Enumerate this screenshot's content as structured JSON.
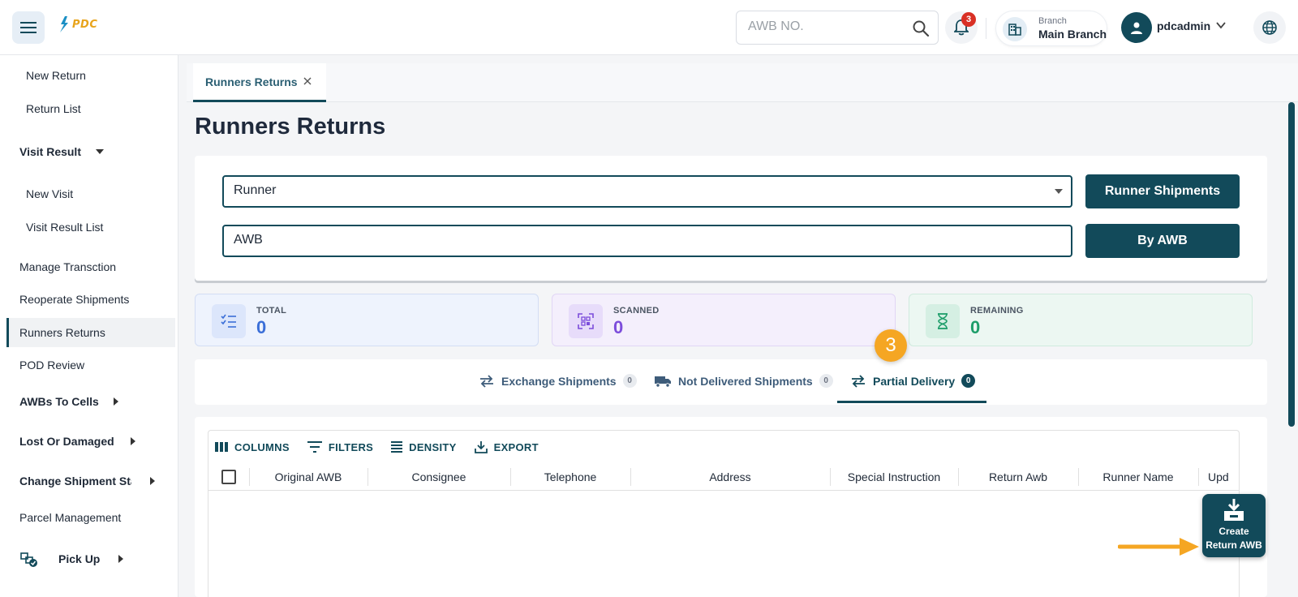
{
  "header": {
    "logo_text": "PDC",
    "search_placeholder": "AWB NO.",
    "notification_count": "3",
    "branch_caption": "Branch",
    "branch_name": "Main Branch",
    "username": "pdcadmin"
  },
  "sidebar": {
    "items": [
      {
        "label": "New Return"
      },
      {
        "label": "Return List"
      },
      {
        "label": "Visit Result"
      },
      {
        "label": "New Visit"
      },
      {
        "label": "Visit Result List"
      },
      {
        "label": "Manage Transction"
      },
      {
        "label": "Reoperate Shipments"
      },
      {
        "label": "Runners Returns"
      },
      {
        "label": "POD Review"
      },
      {
        "label": "AWBs To Cells"
      },
      {
        "label": "Lost Or Damaged"
      },
      {
        "label": "Change Shipment Sta"
      },
      {
        "label": "Parcel Management"
      },
      {
        "label": "Pick Up"
      }
    ]
  },
  "tabs": {
    "active_tab": "Runners Returns"
  },
  "page": {
    "title": "Runners Returns"
  },
  "form": {
    "runner_placeholder": "Runner",
    "awb_placeholder": "AWB",
    "runner_button": "Runner Shipments",
    "awb_button": "By AWB"
  },
  "stats": {
    "total_label": "TOTAL",
    "total_value": "0",
    "scanned_label": "SCANNED",
    "scanned_value": "0",
    "remaining_label": "REMAINING",
    "remaining_value": "0"
  },
  "subtabs": {
    "exchange_label": "Exchange Shipments",
    "exchange_count": "0",
    "not_delivered_label": "Not Delivered Shipments",
    "not_delivered_count": "0",
    "partial_label": "Partial Delivery",
    "partial_count": "0",
    "active": "Partial Delivery"
  },
  "step_badge": "3",
  "grid": {
    "toolbar": {
      "columns": "COLUMNS",
      "filters": "FILTERS",
      "density": "DENSITY",
      "export": "EXPORT"
    },
    "columns": [
      "Original AWB",
      "Consignee",
      "Telephone",
      "Address",
      "Special Instruction",
      "Return Awb",
      "Runner Name",
      "Upd"
    ]
  },
  "fab": {
    "line1": "Create",
    "line2": "Return AWB"
  },
  "colors": {
    "primary": "#124a5a",
    "accent": "#f5a623",
    "total_bg": "#eef3fd",
    "scanned_bg": "#f4effc",
    "remaining_bg": "#ecf7f2"
  }
}
